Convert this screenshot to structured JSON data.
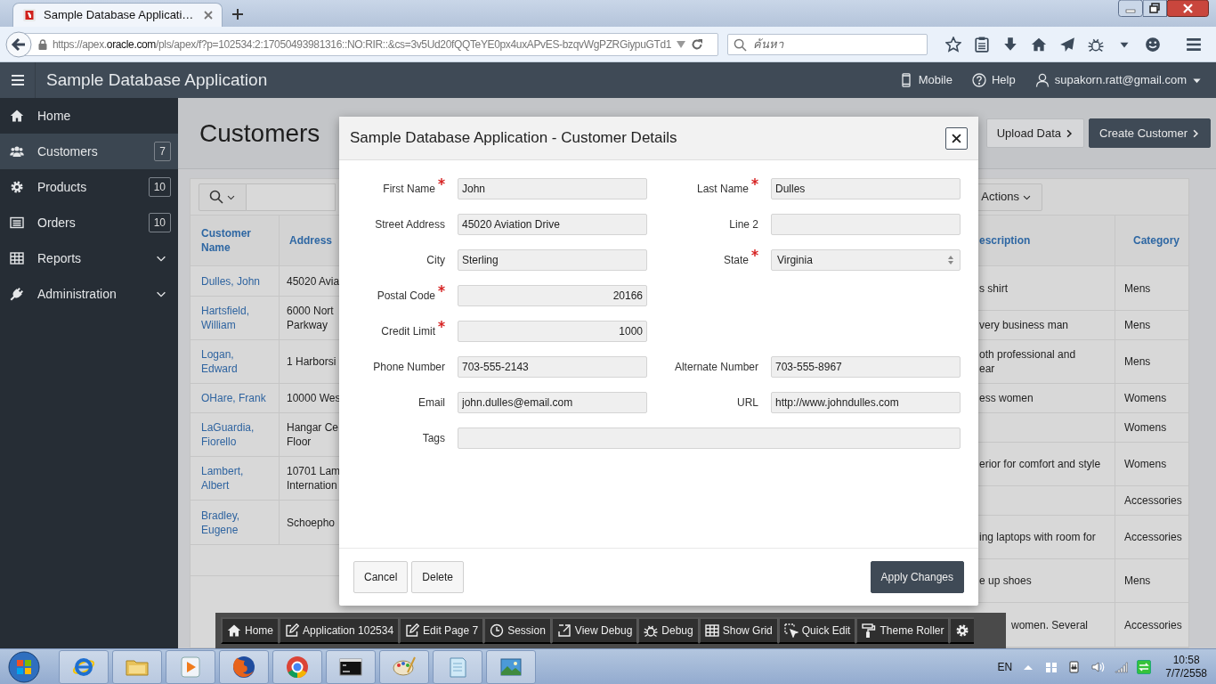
{
  "browser": {
    "tab_title": "Sample Database Applicati…",
    "url": {
      "prefix": "https://apex.",
      "domain": "oracle.com",
      "rest": "/pls/apex/f?p=102534:2:17050493981316::NO:RIR::&cs=3v5Ud20fQQTeYE0px4uxAPvES-bzqvWgPZRGiypuGTd1"
    },
    "search": {
      "placeholder": "ค้นหา"
    }
  },
  "header": {
    "title": "Sample Database Application",
    "links": [
      {
        "label": "Mobile",
        "menu": false
      },
      {
        "label": "Help",
        "menu": false
      },
      {
        "label": "supakorn.ratt@gmail.com",
        "menu": true
      }
    ]
  },
  "sidebar": {
    "items": [
      {
        "label": "Home",
        "kind": "link",
        "selected": false
      },
      {
        "label": "Customers",
        "kind": "link",
        "badge": "7",
        "selected": true
      },
      {
        "label": "Products",
        "kind": "link",
        "badge": "10",
        "selected": false
      },
      {
        "label": "Orders",
        "kind": "link",
        "badge": "10",
        "selected": false
      },
      {
        "label": "Reports",
        "kind": "group",
        "expanded": false,
        "selected": false
      },
      {
        "label": "Administration",
        "kind": "group",
        "expanded": false,
        "selected": false
      }
    ]
  },
  "page": {
    "title": "Customers",
    "buttons": [
      {
        "label": "Upload Data",
        "kind": "secondary"
      },
      {
        "label": "Create Customer",
        "kind": "primary"
      }
    ]
  },
  "report": {
    "actions_label": "Actions",
    "left_columns": [
      "Customer Name",
      "Address"
    ],
    "left_rows": [
      [
        "Dulles, John",
        "45020 Avia"
      ],
      [
        "Hartsfield, William",
        "6000 Nort\nParkway"
      ],
      [
        "Logan, Edward",
        "1 Harborsi"
      ],
      [
        "OHare, Frank",
        "10000 Wes"
      ],
      [
        "LaGuardia, Fiorello",
        "Hangar Ce\nFloor"
      ],
      [
        "Lambert, Albert",
        "10701 Lam\nInternation"
      ],
      [
        "Bradley, Eugene",
        "Schoepho"
      ]
    ],
    "right_columns": [
      "escription",
      "Category"
    ],
    "right_rows": [
      {
        "description": "s shirt",
        "category": "Mens"
      },
      {
        "description": "very business man",
        "category": "Mens"
      },
      {
        "description": "oth professional and\near",
        "category": "Mens"
      },
      {
        "description": "ess women",
        "category": "Womens"
      },
      {
        "category": "Womens"
      },
      {
        "description": "erior for comfort and style",
        "category": "Womens"
      },
      {
        "category": "Accessories"
      },
      {
        "description": "ing laptops with room for",
        "category": "Accessories"
      },
      {
        "description": "e up shoes",
        "category": "Mens"
      },
      {
        "description": "women. Several",
        "category": "Accessories"
      }
    ]
  },
  "modal": {
    "title": "Sample Database Application - Customer Details",
    "rows": [
      {
        "fields": [
          {
            "label": "First Name",
            "value": "John",
            "required": true,
            "kind": "text"
          },
          {
            "label": "Last Name",
            "value": "Dulles",
            "required": true,
            "kind": "text"
          }
        ]
      },
      {
        "fields": [
          {
            "label": "Street Address",
            "value": "45020 Aviation Drive",
            "required": false,
            "kind": "text"
          },
          {
            "label": "Line 2",
            "required": false,
            "kind": "text"
          }
        ]
      },
      {
        "fields": [
          {
            "label": "City",
            "value": "Sterling",
            "required": false,
            "kind": "text"
          },
          {
            "label": "State",
            "value": "Virginia",
            "required": true,
            "kind": "select"
          }
        ]
      },
      {
        "fields": [
          {
            "label": "Postal Code",
            "value": "20166",
            "required": true,
            "kind": "number"
          }
        ]
      },
      {
        "fields": [
          {
            "label": "Credit Limit",
            "value": "1000",
            "required": true,
            "kind": "number"
          }
        ]
      },
      {
        "fields": [
          {
            "label": "Phone Number",
            "value": "703-555-2143",
            "required": false,
            "kind": "text"
          },
          {
            "label": "Alternate Number",
            "value": "703-555-8967",
            "required": false,
            "kind": "text"
          }
        ]
      },
      {
        "fields": [
          {
            "label": "Email",
            "value": "john.dulles@email.com",
            "required": false,
            "kind": "text"
          },
          {
            "label": "URL",
            "value": "http://www.johndulles.com",
            "required": false,
            "kind": "text"
          }
        ]
      },
      {
        "wide": true,
        "fields": [
          {
            "label": "Tags",
            "required": false,
            "kind": "text"
          }
        ]
      }
    ],
    "buttons": [
      {
        "label": "Cancel",
        "kind": "secondary"
      },
      {
        "label": "Delete",
        "kind": "secondary"
      },
      {
        "label": "Apply Changes",
        "kind": "primary"
      }
    ]
  },
  "dev_toolbar": {
    "items": [
      {
        "label": "Home"
      },
      {
        "label": "Application 102534"
      },
      {
        "label": "Edit Page 7"
      },
      {
        "label": "Session"
      },
      {
        "label": "View Debug"
      },
      {
        "label": "Debug"
      },
      {
        "label": "Show Grid"
      },
      {
        "label": "Quick Edit"
      },
      {
        "label": "Theme Roller"
      }
    ]
  },
  "taskbar": {
    "language": "EN",
    "time": "10:58",
    "date": "7/7/2558"
  }
}
